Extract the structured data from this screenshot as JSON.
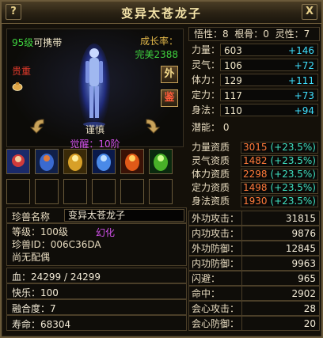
{
  "window": {
    "title": "变异太苍龙子",
    "help_label": "?",
    "close_label": "X"
  },
  "pet": {
    "level": "95级",
    "carry": "可携带",
    "growth_label": "成长率：",
    "growth_value": "完美2388",
    "tag": "贵重",
    "btn_wai": "外",
    "btn_jian": "鉴",
    "disposition": "谨慎",
    "awaken": "觉醒：10阶"
  },
  "skills": [
    "skill-1",
    "skill-2",
    "skill-3",
    "skill-4",
    "skill-5",
    "skill-6"
  ],
  "info": {
    "name_label": "珍兽名称",
    "name_value": "变异太苍龙子",
    "level_line": "等级：100级",
    "mutate": "幻化",
    "id_line": "珍兽ID：006C36DA",
    "partner_line": "尚无配偶",
    "hp_line": "血：24299 / 24299",
    "happy_line": "快乐：100",
    "fusion_line": "融合度：7",
    "life_line": "寿命：68304"
  },
  "attrs_top": {
    "wuxing": "悟性：8",
    "gengu": "根骨：0",
    "lingxing": "灵性：7"
  },
  "stats": [
    {
      "k": "力量：",
      "v": "603",
      "bonus": "+146"
    },
    {
      "k": "灵气：",
      "v": "106",
      "bonus": "+72"
    },
    {
      "k": "体力：",
      "v": "129",
      "bonus": "+111"
    },
    {
      "k": "定力：",
      "v": "117",
      "bonus": "+73"
    },
    {
      "k": "身法：",
      "v": "110",
      "bonus": "+94"
    }
  ],
  "potential": "潜能：  0",
  "aptitudes": [
    {
      "k": "力量资质",
      "v": "3015",
      "pct": "(+23.5%)"
    },
    {
      "k": "灵气资质",
      "v": "1482",
      "pct": "(+23.5%)"
    },
    {
      "k": "体力资质",
      "v": "2298",
      "pct": "(+23.5%)"
    },
    {
      "k": "定力资质",
      "v": "1498",
      "pct": "(+23.5%)"
    },
    {
      "k": "身法资质",
      "v": "1930",
      "pct": "(+23.5%)"
    }
  ],
  "combat": [
    {
      "k": "外功攻击：",
      "v": "31815"
    },
    {
      "k": "内功攻击：",
      "v": "9876"
    },
    {
      "k": "外功防御：",
      "v": "12845"
    },
    {
      "k": "内功防御：",
      "v": "9963"
    },
    {
      "k": "闪避：",
      "v": "965"
    },
    {
      "k": "命中：",
      "v": "2902"
    },
    {
      "k": "会心攻击：",
      "v": "28"
    },
    {
      "k": "会心防御：",
      "v": "20"
    }
  ]
}
